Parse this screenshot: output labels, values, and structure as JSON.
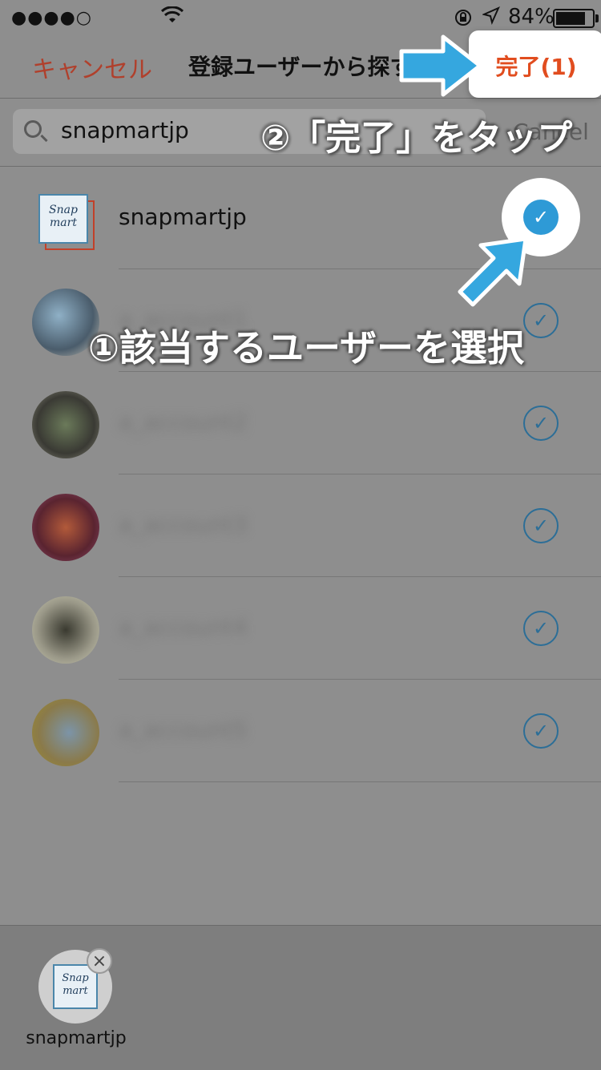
{
  "status": {
    "signal": "●●●●○",
    "battery": "84%"
  },
  "nav": {
    "cancel": "キャンセル",
    "title": "登録ユーザーから探す",
    "done": "完了(1)"
  },
  "search": {
    "value": "snapmartjp",
    "cancel": "Cancel"
  },
  "rows": [
    {
      "username": "snapmartjp",
      "selected": true
    },
    {
      "username": "a_account1",
      "selected": false
    },
    {
      "username": "a_account2",
      "selected": false
    },
    {
      "username": "a_account3",
      "selected": false
    },
    {
      "username": "a_account4",
      "selected": false
    },
    {
      "username": "a_account5",
      "selected": false
    }
  ],
  "logo": {
    "line1": "Snap",
    "line2": "mart"
  },
  "selected_bar": {
    "label": "snapmartjp"
  },
  "annotations": {
    "step1": "①該当するユーザーを選択",
    "step2": "②「完了」をタップ"
  },
  "colors": {
    "accent_red": "#e14d1f",
    "check_blue": "#2e9ad6",
    "arrow_blue": "#35a7df"
  },
  "icons": [
    "search-icon",
    "check-icon",
    "close-icon",
    "wifi-icon",
    "location-icon",
    "battery-icon",
    "lock-rotation-icon"
  ]
}
